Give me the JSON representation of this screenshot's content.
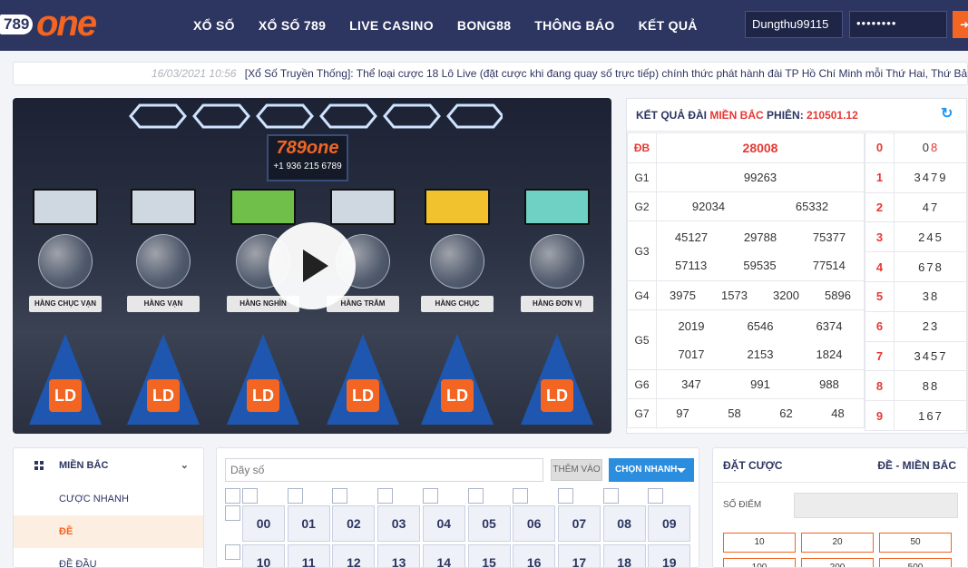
{
  "header": {
    "logo_num": "789",
    "logo_word": "one",
    "nav": [
      "XỔ SỐ",
      "XỔ SỐ 789",
      "LIVE CASINO",
      "BONG88",
      "THÔNG BÁO",
      "KẾT QUẢ"
    ],
    "username": "Dungthu99115",
    "password_mask": "••••••••",
    "login_icon": "arrow-icon"
  },
  "ticker": {
    "date": "16/03/2021 10:56",
    "text": "[Xổ Số Truyền Thống]: Thể loại cược 18 Lô Live (đặt cược khi đang quay số trực tiếp) chính thức phát hành đài TP Hồ Chí Minh mỗi Thứ Hai, Thứ Bảy hàng tu"
  },
  "video": {
    "sign_logo": "789one",
    "sign_phone": "+1 936 215 6789",
    "machines": [
      "HÀNG CHỤC VẠN",
      "HÀNG VẠN",
      "HÀNG NGHÌN",
      "HÀNG TRĂM",
      "HÀNG CHỤC",
      "HÀNG ĐƠN VỊ"
    ],
    "screen_colors": [
      "#cfd8e0",
      "#cfd8e0",
      "#6fbf4a",
      "#cfd8e0",
      "#f2c12e",
      "#6fd0c4"
    ],
    "machine_mark": "LD"
  },
  "results": {
    "title_prefix": "KẾT QUẢ ĐÀI",
    "region": "MIỀN BẮC",
    "session_label": "PHIÊN:",
    "session": "210501.12",
    "refresh_icon": "refresh-icon",
    "rows": [
      {
        "label": "ĐB",
        "values": [
          "28008"
        ],
        "special": true
      },
      {
        "label": "G1",
        "values": [
          "99263"
        ]
      },
      {
        "label": "G2",
        "values": [
          "92034",
          "65332"
        ]
      },
      {
        "label": "G3",
        "values": [
          "45127",
          "29788",
          "75377",
          "57113",
          "59535",
          "77514"
        ]
      },
      {
        "label": "G4",
        "values": [
          "3975",
          "1573",
          "3200",
          "5896"
        ]
      },
      {
        "label": "G5",
        "values": [
          "2019",
          "6546",
          "6374",
          "7017",
          "2153",
          "1824"
        ]
      },
      {
        "label": "G6",
        "values": [
          "347",
          "991",
          "988"
        ]
      },
      {
        "label": "G7",
        "values": [
          "97",
          "58",
          "62",
          "48"
        ]
      }
    ],
    "tails": [
      {
        "k": "0",
        "v": "0",
        "hl": "8"
      },
      {
        "k": "1",
        "v": "3479"
      },
      {
        "k": "2",
        "v": "47"
      },
      {
        "k": "3",
        "v": "245"
      },
      {
        "k": "4",
        "v": "678"
      },
      {
        "k": "5",
        "v": "38"
      },
      {
        "k": "6",
        "v": "23"
      },
      {
        "k": "7",
        "v": "3457"
      },
      {
        "k": "8",
        "v": "88"
      },
      {
        "k": "9",
        "v": "167"
      }
    ]
  },
  "menu": {
    "head": "MIỀN BẮC",
    "items": [
      "CƯỢC NHANH",
      "ĐỀ",
      "ĐỀ ĐẦU"
    ],
    "active_index": 1
  },
  "numpad": {
    "placeholder": "Dãy số",
    "add_label": "THÊM VÀO",
    "quick_label": "CHỌN NHANH",
    "numbers": [
      "00",
      "01",
      "02",
      "03",
      "04",
      "05",
      "06",
      "07",
      "08",
      "09",
      "10",
      "11",
      "12",
      "13",
      "14",
      "15",
      "16",
      "17",
      "18",
      "19"
    ]
  },
  "bet": {
    "title": "ĐẶT CƯỢC",
    "mode": "ĐỀ - MIỀN BẮC",
    "points_label": "SỐ ĐIỂM",
    "chips": [
      "10",
      "20",
      "50",
      "100",
      "200",
      "500"
    ]
  }
}
